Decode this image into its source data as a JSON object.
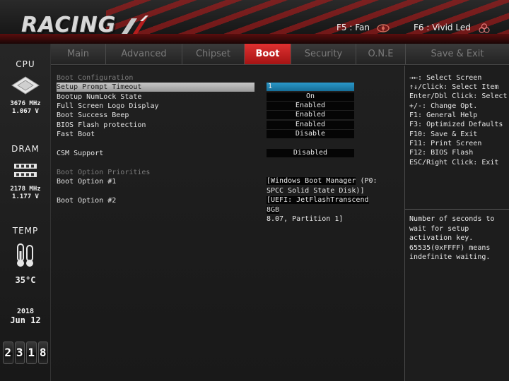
{
  "header": {
    "logo": "RACING",
    "hotkeys": [
      {
        "label": "F5 : Fan",
        "icon": "fan-icon"
      },
      {
        "label": "F6 : Vivid Led",
        "icon": "led-icon"
      }
    ]
  },
  "sidebar": {
    "cpu": {
      "title": "CPU",
      "freq": "3676 MHz",
      "volt": "1.067 V",
      "icon": "cpu-chip-icon"
    },
    "dram": {
      "title": "DRAM",
      "freq": "2178 MHz",
      "volt": "1.177 V",
      "icon": "memory-module-icon"
    },
    "temp": {
      "title": "TEMP",
      "value": "35°C",
      "icon": "thermometer-icon"
    },
    "date": {
      "year": "2018",
      "month_day": "Jun 12"
    },
    "clock": {
      "h1": "2",
      "h2": "3",
      "m1": "1",
      "m2": "8"
    }
  },
  "tabs": [
    "Main",
    "Advanced",
    "Chipset",
    "Boot",
    "Security",
    "O.N.E",
    "Save & Exit"
  ],
  "active_tab": "Boot",
  "main": {
    "boot_config_heading": "Boot Configuration",
    "settings": [
      {
        "label": "Setup Prompt Timeout",
        "value": "1"
      },
      {
        "label": "Bootup NumLock State",
        "value": "On"
      },
      {
        "label": "Full Screen Logo Display",
        "value": "Enabled"
      },
      {
        "label": "Boot Success Beep",
        "value": "Enabled"
      },
      {
        "label": "BIOS Flash protection",
        "value": "Enabled"
      },
      {
        "label": "Fast Boot",
        "value": "Disable"
      }
    ],
    "csm": {
      "label": "CSM Support",
      "value": "Disabled"
    },
    "priorities_heading": "Boot Option Priorities",
    "boot_options": [
      {
        "label": "Boot Option #1",
        "value_line1": "[Windows Boot Manager",
        "value_line1_tail": " (P0:",
        "value_line2": "SPCC Solid State Disk)]"
      },
      {
        "label": "Boot Option #2",
        "value_line1": "[UEFI: JetFlashTranscend 8GB",
        "value_line1_tail": "",
        "value_line2": "8.07, Partition 1]"
      }
    ]
  },
  "help": {
    "keys": [
      "→←: Select Screen",
      "↑↓/Click: Select Item",
      "Enter/Dbl Click: Select",
      "+/-: Change Opt.",
      "F1: General Help",
      "F3: Optimized Defaults",
      "F10: Save & Exit",
      "F11: Print Screen",
      "F12: BIOS Flash",
      "ESC/Right Click: Exit"
    ],
    "description": [
      "Number of seconds to",
      "wait for setup",
      "activation key.",
      "65535(0xFFFF) means",
      "indefinite waiting."
    ]
  },
  "colors": {
    "accent_red": "#c81e1e",
    "selected_value_blue": "#2a98c9"
  }
}
